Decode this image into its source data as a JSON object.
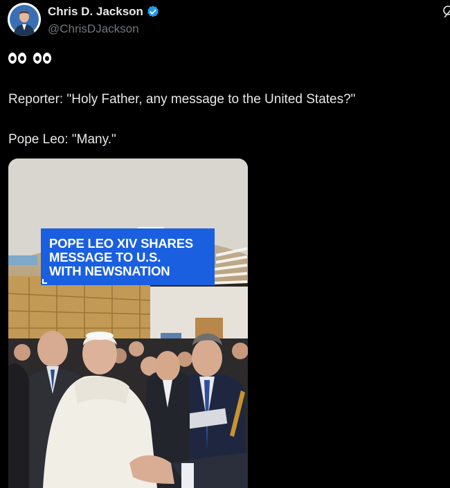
{
  "header": {
    "display_name": "Chris D. Jackson",
    "handle": "@ChrisDJackson",
    "verified": true,
    "avatar_icon": "profile-photo",
    "top_right_icon": "grok-icon"
  },
  "tweet": {
    "emoji": "👀 👀",
    "line1": "Reporter: \"Holy Father, any message to the United States?\"",
    "line2": "Pope Leo: \"Many.\""
  },
  "media": {
    "type": "video-thumbnail",
    "caption_lines": [
      "POPE LEO XIV SHARES",
      "MESSAGE TO U.S.",
      "WITH NEWSNATION"
    ],
    "caption_color": "#1a5fe0"
  },
  "colors": {
    "background": "#000000",
    "text_primary": "#e7e9ea",
    "text_secondary": "#71767b",
    "verified_blue": "#1d9bf0"
  }
}
